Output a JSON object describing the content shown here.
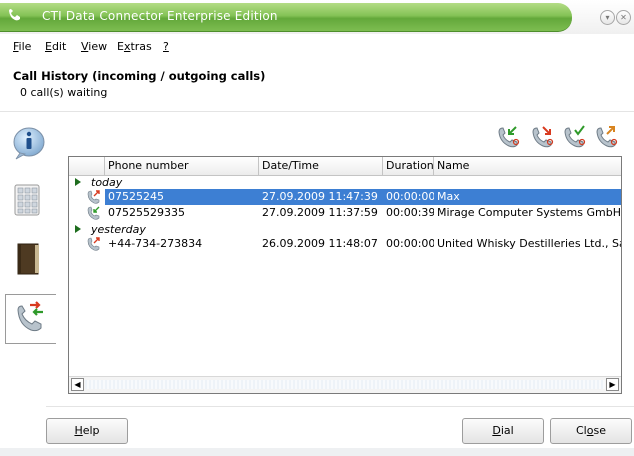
{
  "window": {
    "title": "CTI Data Connector Enterprise Edition"
  },
  "menu": [
    {
      "accel": "F",
      "rest": "ile"
    },
    {
      "accel": "E",
      "rest": "dit"
    },
    {
      "accel": "V",
      "rest": "iew"
    },
    {
      "pre": "E",
      "accel": "x",
      "rest": "tras"
    },
    {
      "accel": "?",
      "rest": ""
    }
  ],
  "page": {
    "heading": "Call History (incoming / outgoing calls)",
    "waiting": "0 call(s) waiting"
  },
  "table": {
    "columns": [
      "Phone number",
      "Date/Time",
      "Duration",
      "Name"
    ],
    "groups": [
      {
        "label": "today",
        "rows": [
          {
            "icon": "outgoing-call-icon",
            "phone": "07525245",
            "datetime": "27.09.2009 11:47:39",
            "duration": "00:00:00",
            "name": "Max",
            "selected": true
          },
          {
            "icon": "incoming-call-icon",
            "phone": "07525529335",
            "datetime": "27.09.2009 11:37:59",
            "duration": "00:00:39",
            "name": "Mirage Computer Systems GmbH, Sal"
          }
        ]
      },
      {
        "label": "yesterday",
        "rows": [
          {
            "icon": "outgoing-call-icon",
            "phone": "+44-734-273834",
            "datetime": "26.09.2009 11:48:07",
            "duration": "00:00:00",
            "name": "United Whisky Destilleries Ltd., Sandr"
          }
        ]
      }
    ]
  },
  "buttons": {
    "help": {
      "accel": "H",
      "rest": "elp"
    },
    "dial": {
      "accel": "D",
      "rest": "ial"
    },
    "close": {
      "pre": "Cl",
      "accel": "o",
      "rest": "se"
    }
  },
  "toolbar_icons": [
    "call-in-icon",
    "call-missed-icon",
    "call-ok-icon",
    "call-out-icon"
  ],
  "colors": {
    "title_green": "#7dbd51",
    "selection_blue": "#3d7fd3"
  }
}
